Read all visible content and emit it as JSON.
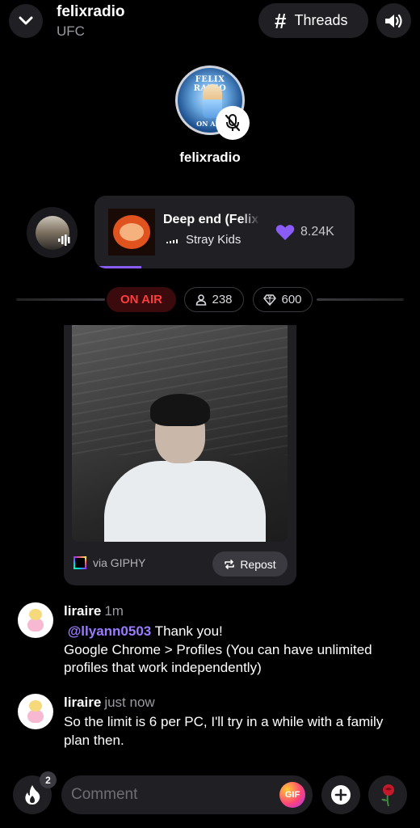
{
  "header": {
    "title": "felixradio",
    "subtitle": "UFC",
    "threads_label": "Threads"
  },
  "host": {
    "name": "felixradio",
    "avatar_text_top": "FELIX RADIO",
    "avatar_text_bottom": "ON AIR",
    "mic_state": "muted"
  },
  "now_playing": {
    "title": "Deep end (Felix Solo)",
    "artist": "Stray Kids",
    "likes": "8.24K",
    "progress": 0.18,
    "accent": "#8a5cf6"
  },
  "status": {
    "on_air": "ON AIR",
    "listeners": "238",
    "diamonds": "600"
  },
  "gif": {
    "via": "via GIPHY",
    "repost_label": "Repost"
  },
  "comments": [
    {
      "user": "liraire",
      "time": "1m",
      "mention": "@llyann0503",
      "text_after_mention": " Thank you!",
      "text": "Google Chrome > Profiles (You can have unlimited profiles that work independently)"
    },
    {
      "user": "liraire",
      "time": "just now",
      "text": "So the limit is 6 per PC, I'll try in a while with a family plan then."
    }
  ],
  "bottom_bar": {
    "fire_count": "2",
    "comment_placeholder": "Comment",
    "gif_label": "GIF"
  },
  "icons": {
    "collapse": "chevron-down-icon",
    "threads": "hash-icon",
    "volume": "speaker-icon",
    "mic": "mic-off-icon",
    "heart": "heart-icon",
    "listeners": "person-icon",
    "diamonds": "diamond-icon",
    "repost": "repost-icon",
    "fire": "fire-icon",
    "add": "plus-icon",
    "rose": "rose-icon"
  }
}
